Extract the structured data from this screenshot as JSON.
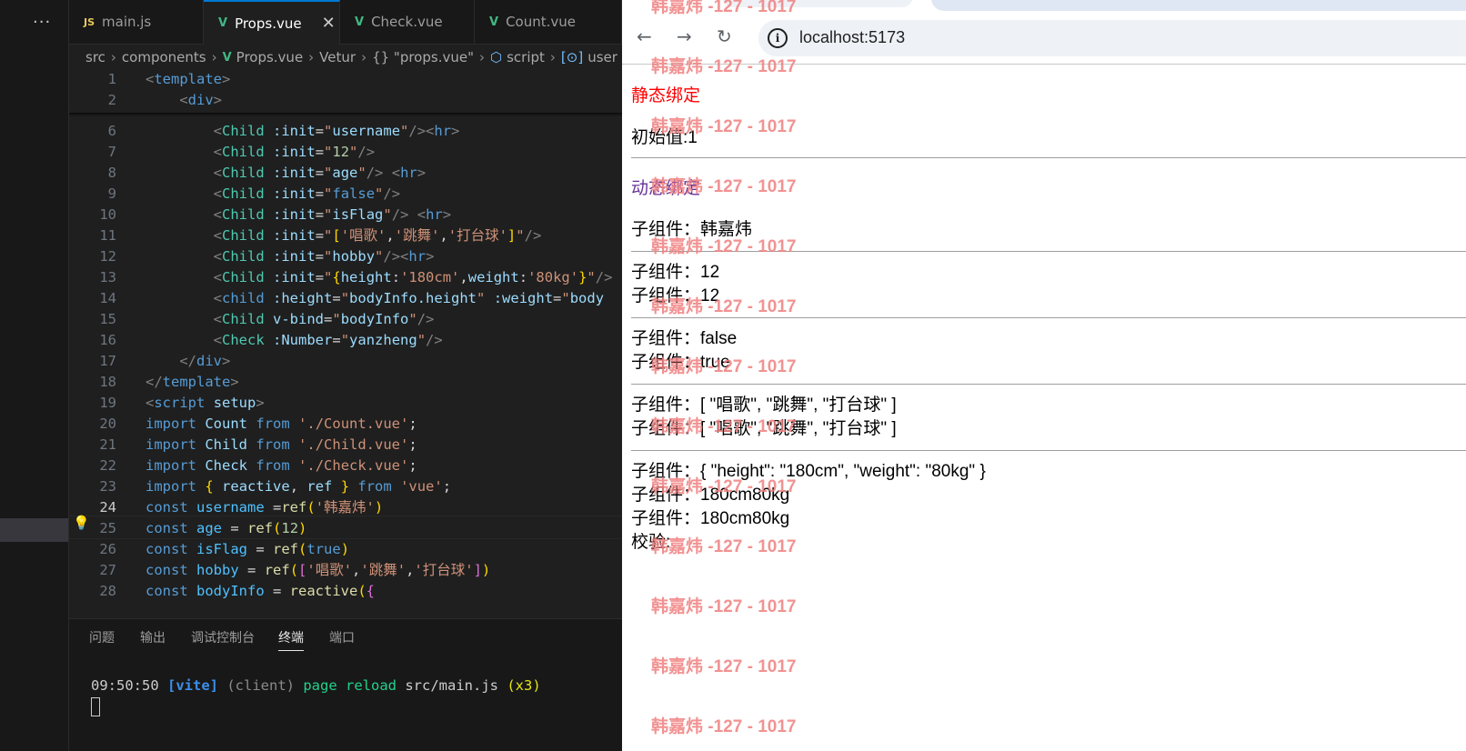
{
  "vscode": {
    "activity": {
      "more": "···"
    },
    "tabs": [
      {
        "label": "main.js",
        "icon": "JS"
      },
      {
        "label": "Props.vue",
        "icon": "V",
        "close": "✕"
      },
      {
        "label": "Check.vue",
        "icon": "V"
      },
      {
        "label": "Count.vue",
        "icon": "V"
      }
    ],
    "breadcrumb": [
      "src",
      "components",
      "Props.vue",
      "Vetur",
      "{} \"props.vue\"",
      "script",
      "user"
    ],
    "code_lines": [
      {
        "n": "1",
        "html": "<span class='t-br'>&lt;</span><span class='t-tag'>template</span><span class='t-br'>&gt;</span>"
      },
      {
        "n": "2",
        "html": "    <span class='t-br'>&lt;</span><span class='t-tag'>div</span><span class='t-br'>&gt;</span>"
      },
      {
        "n": "6",
        "html": "        <span class='t-br'>&lt;</span><span class='t-comp'>Child</span> <span class='t-attr'>:init</span>=<span class='t-str'>\"</span><span class='t-attr'>username</span><span class='t-str'>\"</span><span class='t-br'>/&gt;&lt;</span><span class='t-tag'>hr</span><span class='t-br'>&gt;</span>"
      },
      {
        "n": "7",
        "html": "        <span class='t-br'>&lt;</span><span class='t-comp'>Child</span> <span class='t-attr'>:init</span>=<span class='t-str'>\"</span><span class='t-num'>12</span><span class='t-str'>\"</span><span class='t-br'>/&gt;</span>"
      },
      {
        "n": "8",
        "html": "        <span class='t-br'>&lt;</span><span class='t-comp'>Child</span> <span class='t-attr'>:init</span>=<span class='t-str'>\"</span><span class='t-attr'>age</span><span class='t-str'>\"</span><span class='t-br'>/&gt;</span> <span class='t-br'>&lt;</span><span class='t-tag'>hr</span><span class='t-br'>&gt;</span>"
      },
      {
        "n": "9",
        "html": "        <span class='t-br'>&lt;</span><span class='t-comp'>Child</span> <span class='t-attr'>:init</span>=<span class='t-str'>\"</span><span class='t-kw'>false</span><span class='t-str'>\"</span><span class='t-br'>/&gt;</span>"
      },
      {
        "n": "10",
        "html": "        <span class='t-br'>&lt;</span><span class='t-comp'>Child</span> <span class='t-attr'>:init</span>=<span class='t-str'>\"</span><span class='t-attr'>isFlag</span><span class='t-str'>\"</span><span class='t-br'>/&gt;</span> <span class='t-br'>&lt;</span><span class='t-tag'>hr</span><span class='t-br'>&gt;</span>"
      },
      {
        "n": "11",
        "html": "        <span class='t-br'>&lt;</span><span class='t-comp'>Child</span> <span class='t-attr'>:init</span>=<span class='t-str'>\"</span><span class='t-p1'>[</span><span class='t-str'>'唱歌'</span>,<span class='t-str'>'跳舞'</span>,<span class='t-str'>'打台球'</span><span class='t-p1'>]</span><span class='t-str'>\"</span><span class='t-br'>/&gt;</span>"
      },
      {
        "n": "12",
        "html": "        <span class='t-br'>&lt;</span><span class='t-comp'>Child</span> <span class='t-attr'>:init</span>=<span class='t-str'>\"</span><span class='t-attr'>hobby</span><span class='t-str'>\"</span><span class='t-br'>/&gt;&lt;</span><span class='t-tag'>hr</span><span class='t-br'>&gt;</span>"
      },
      {
        "n": "13",
        "html": "        <span class='t-br'>&lt;</span><span class='t-comp'>Child</span> <span class='t-attr'>:init</span>=<span class='t-str'>\"</span><span class='t-p1'>{</span><span class='t-attr'>height</span>:<span class='t-str'>'180cm'</span>,<span class='t-attr'>weight</span>:<span class='t-str'>'80kg'</span><span class='t-p1'>}</span><span class='t-str'>\"</span><span class='t-br'>/&gt;</span>"
      },
      {
        "n": "14",
        "html": "        <span class='t-br'>&lt;</span><span class='t-tag'>child</span> <span class='t-attr'>:height</span>=<span class='t-str'>\"</span><span class='t-attr'>bodyInfo.height</span><span class='t-str'>\"</span> <span class='t-attr'>:weight</span>=<span class='t-str'>\"</span><span class='t-attr'>body</span>"
      },
      {
        "n": "15",
        "html": "        <span class='t-br'>&lt;</span><span class='t-comp'>Child</span> <span class='t-attr'>v-bind</span>=<span class='t-str'>\"</span><span class='t-attr'>bodyInfo</span><span class='t-str'>\"</span><span class='t-br'>/&gt;</span>"
      },
      {
        "n": "16",
        "html": "        <span class='t-br'>&lt;</span><span class='t-comp'>Check</span> <span class='t-attr'>:Number</span>=<span class='t-str'>\"</span><span class='t-attr'>yanzheng</span><span class='t-str'>\"</span><span class='t-br'>/&gt;</span>"
      },
      {
        "n": "17",
        "html": "    <span class='t-br'>&lt;/</span><span class='t-tag'>div</span><span class='t-br'>&gt;</span>"
      },
      {
        "n": "18",
        "html": "<span class='t-br'>&lt;/</span><span class='t-tag'>template</span><span class='t-br'>&gt;</span>"
      },
      {
        "n": "19",
        "html": "<span class='t-br'>&lt;</span><span class='t-tag'>script</span> <span class='t-attr'>setup</span><span class='t-br'>&gt;</span>"
      },
      {
        "n": "20",
        "html": "<span class='t-kw'>import</span> <span class='t-attr'>Count</span> <span class='t-kw'>from</span> <span class='t-str'>'./Count.vue'</span>;"
      },
      {
        "n": "21",
        "html": "<span class='t-kw'>import</span> <span class='t-attr'>Child</span> <span class='t-kw'>from</span> <span class='t-str'>'./Child.vue'</span>;"
      },
      {
        "n": "22",
        "html": "<span class='t-kw'>import</span> <span class='t-attr'>Check</span> <span class='t-kw'>from</span> <span class='t-str'>'./Check.vue'</span>;"
      },
      {
        "n": "23",
        "html": "<span class='t-kw'>import</span> <span class='t-p1'>{</span> <span class='t-attr'>reactive</span>, <span class='t-attr'>ref</span> <span class='t-p1'>}</span> <span class='t-kw'>from</span> <span class='t-str'>'vue'</span>;"
      },
      {
        "n": "24",
        "html": "<span class='t-kw'>const</span> <span class='t-var'>username</span> =<span class='t-fn'>ref</span><span class='t-p1'>(</span><span class='t-str'>'韩嘉炜'</span><span class='t-p1'>)</span>"
      },
      {
        "n": "25",
        "html": "<span class='t-kw'>const</span> <span class='t-var'>age</span> = <span class='t-fn'>ref</span><span class='t-p1'>(</span><span class='t-num'>12</span><span class='t-p1'>)</span>"
      },
      {
        "n": "26",
        "html": "<span class='t-kw'>const</span> <span class='t-var'>isFlag</span> = <span class='t-fn'>ref</span><span class='t-p1'>(</span><span class='t-kw'>true</span><span class='t-p1'>)</span>"
      },
      {
        "n": "27",
        "html": "<span class='t-kw'>const</span> <span class='t-var'>hobby</span> = <span class='t-fn'>ref</span><span class='t-p1'>(</span><span class='t-p2'>[</span><span class='t-str'>'唱歌'</span>,<span class='t-str'>'跳舞'</span>,<span class='t-str'>'打台球'</span><span class='t-p2'>]</span><span class='t-p1'>)</span>"
      },
      {
        "n": "28",
        "html": "<span class='t-kw'>const</span> <span class='t-var'>bodyInfo</span> = <span class='t-fn'>reactive</span><span class='t-p1'>(</span><span class='t-p2'>{</span>"
      }
    ],
    "current_line": "24",
    "panel": {
      "tabs": [
        "问题",
        "输出",
        "调试控制台",
        "终端",
        "端口"
      ],
      "active_tab": "终端",
      "terminal_line": "09:50:50 [vite] (client) page reload src/main.js (x3)"
    }
  },
  "browser": {
    "url": "localhost:5173",
    "nav": {
      "back": "←",
      "forward": "→",
      "reload": "↻",
      "info": "i"
    },
    "content": {
      "static_heading": "静态绑定",
      "static_value": "初始值:1",
      "dynamic_heading": "动态绑定",
      "rows": [
        "子组件：韩嘉炜",
        "子组件：12",
        "子组件：12",
        "子组件：false",
        "子组件：true",
        "子组件：[ \"唱歌\", \"跳舞\", \"打台球\" ]",
        "子组件：[ \"唱歌\", \"跳舞\", \"打台球\" ]",
        "子组件：{ \"height\": \"180cm\", \"weight\": \"80kg\" }",
        "子组件：180cm80kg",
        "子组件：180cm80kg"
      ],
      "check_label": "校验:"
    },
    "watermark": "韩嘉炜 -127 - 1017",
    "colors": {
      "static_heading": "#ff0000",
      "dynamic_heading": "#663399",
      "watermark": "#f08080"
    }
  }
}
